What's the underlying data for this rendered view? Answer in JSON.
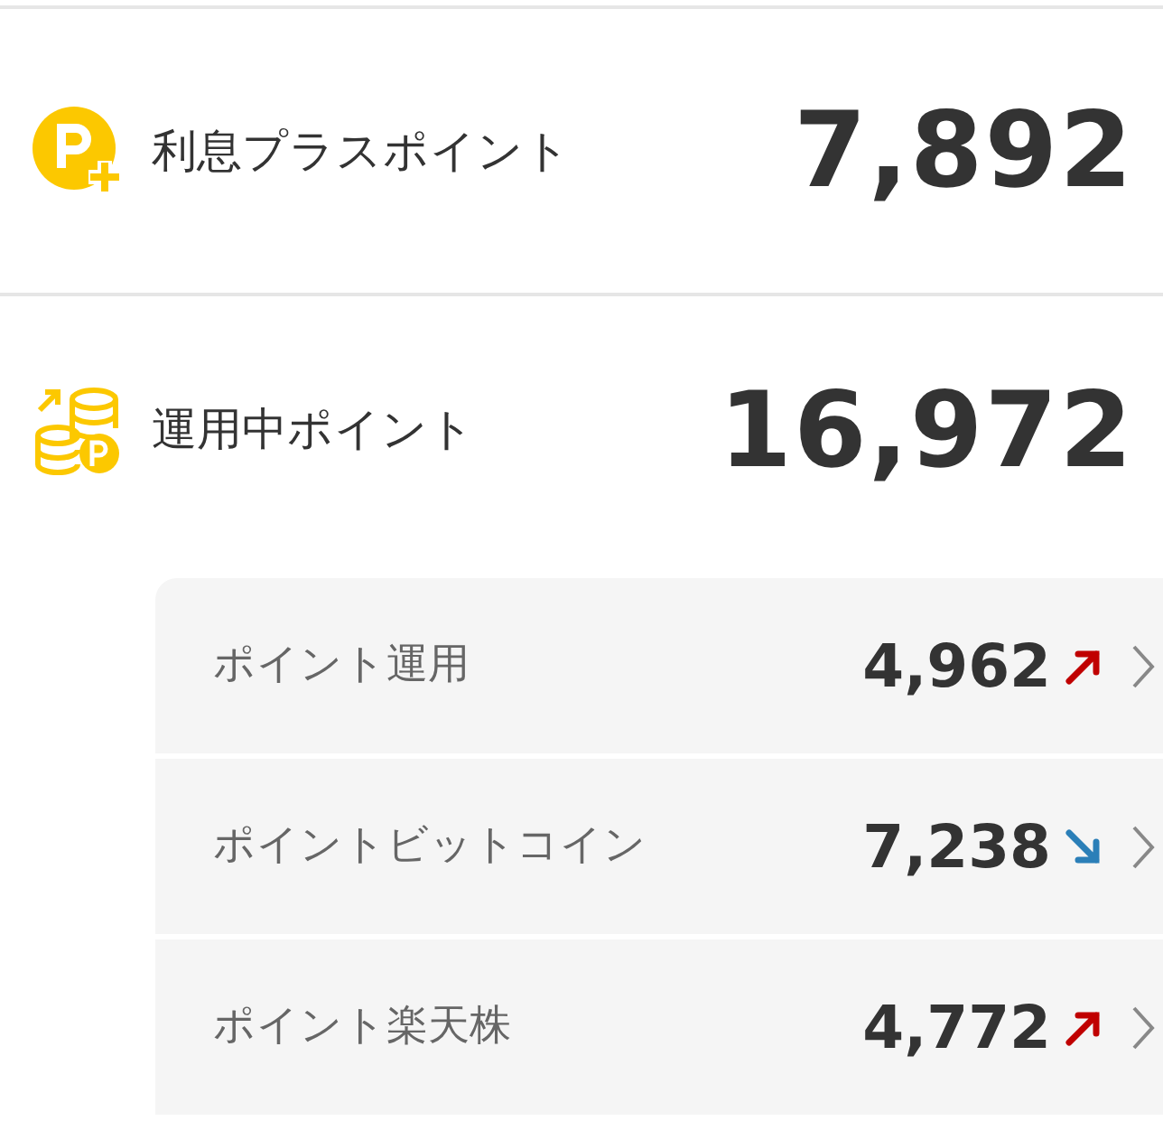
{
  "summary": [
    {
      "kind": "interest",
      "label": "利息プラスポイント",
      "value": "7,892"
    },
    {
      "kind": "invest",
      "label": "運用中ポイント",
      "value": "16,972"
    }
  ],
  "investments": [
    {
      "label": "ポイント運用",
      "value": "4,962",
      "kind": "rising"
    },
    {
      "label": "ポイントビットコイン",
      "value": "7,238",
      "kind": "falling"
    },
    {
      "label": "ポイント楽天株",
      "value": "4,772",
      "kind": "rising"
    }
  ]
}
